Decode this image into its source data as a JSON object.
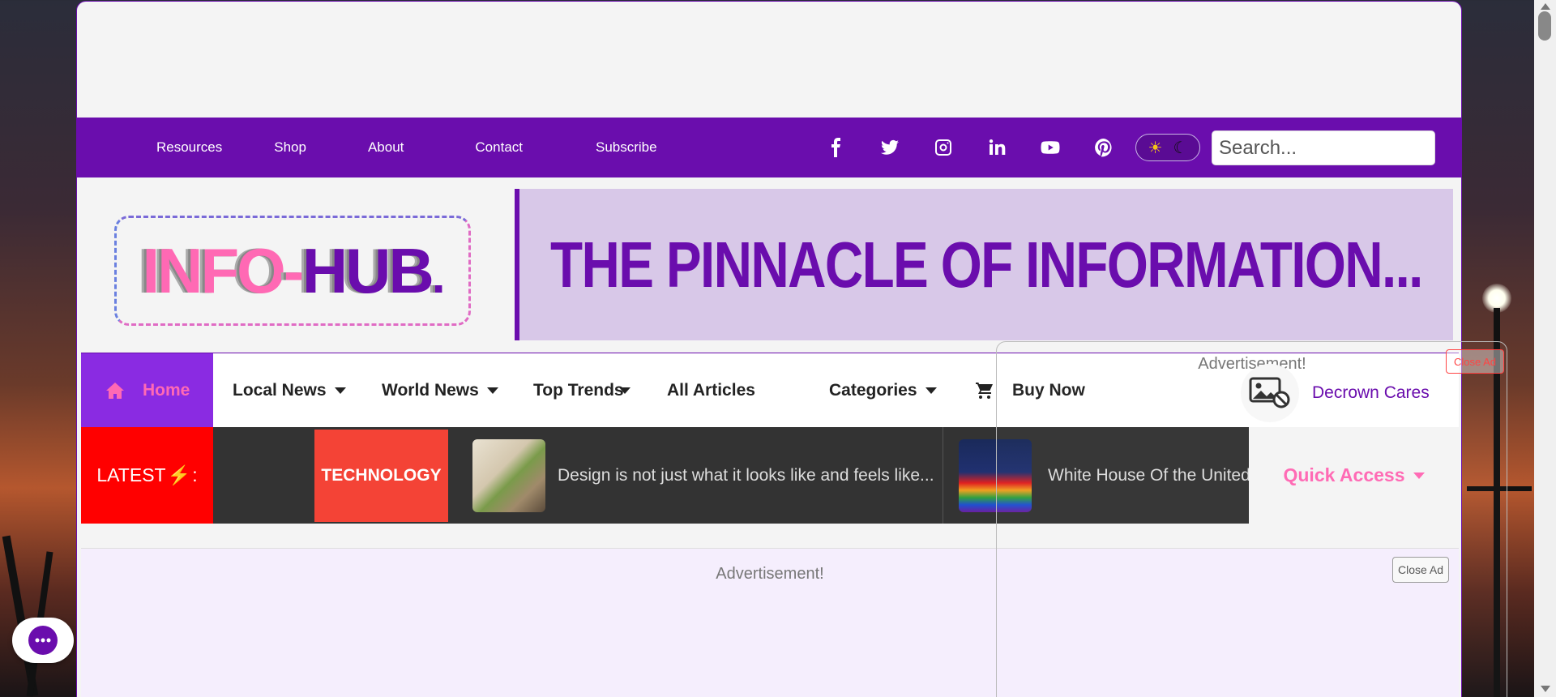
{
  "topnav": {
    "items": [
      "Resources",
      "Shop",
      "About",
      "Contact",
      "Subscribe"
    ]
  },
  "social": {
    "icons": [
      "facebook-icon",
      "twitter-icon",
      "instagram-icon",
      "linkedin-icon",
      "youtube-icon",
      "pinterest-icon"
    ]
  },
  "search": {
    "placeholder": "Search..."
  },
  "logo": {
    "part1": "INFO",
    "dash": "-",
    "part2": "HUB",
    "dot": "."
  },
  "banner": {
    "text": "THE PINNACLE OF INFORMATION..."
  },
  "mainnav": {
    "home": "Home",
    "local_news": "Local News",
    "world_news": "World News",
    "top_trends": "Top Trends",
    "all_articles": "All Articles",
    "categories": "Categories",
    "buy_now": "Buy Now"
  },
  "ticker": {
    "latest_label": "LATEST",
    "latest_suffix": ":",
    "category": "TECHNOLOGY",
    "headline1": "Design is not just what it looks like and feels like...",
    "headline2": "White House Of the UnitedS"
  },
  "quick_access": "Quick Access",
  "ad": {
    "label": "Advertisement!",
    "close": "Close Ad"
  },
  "float_ad": {
    "label": "Advertisement!",
    "close": "Close Ad",
    "sponsor": "Decrown Cares"
  },
  "colors": {
    "brand": "#6a0dad",
    "accent": "#ff69b4",
    "latest_red": "#ff0000",
    "tag_red": "#f44336"
  }
}
